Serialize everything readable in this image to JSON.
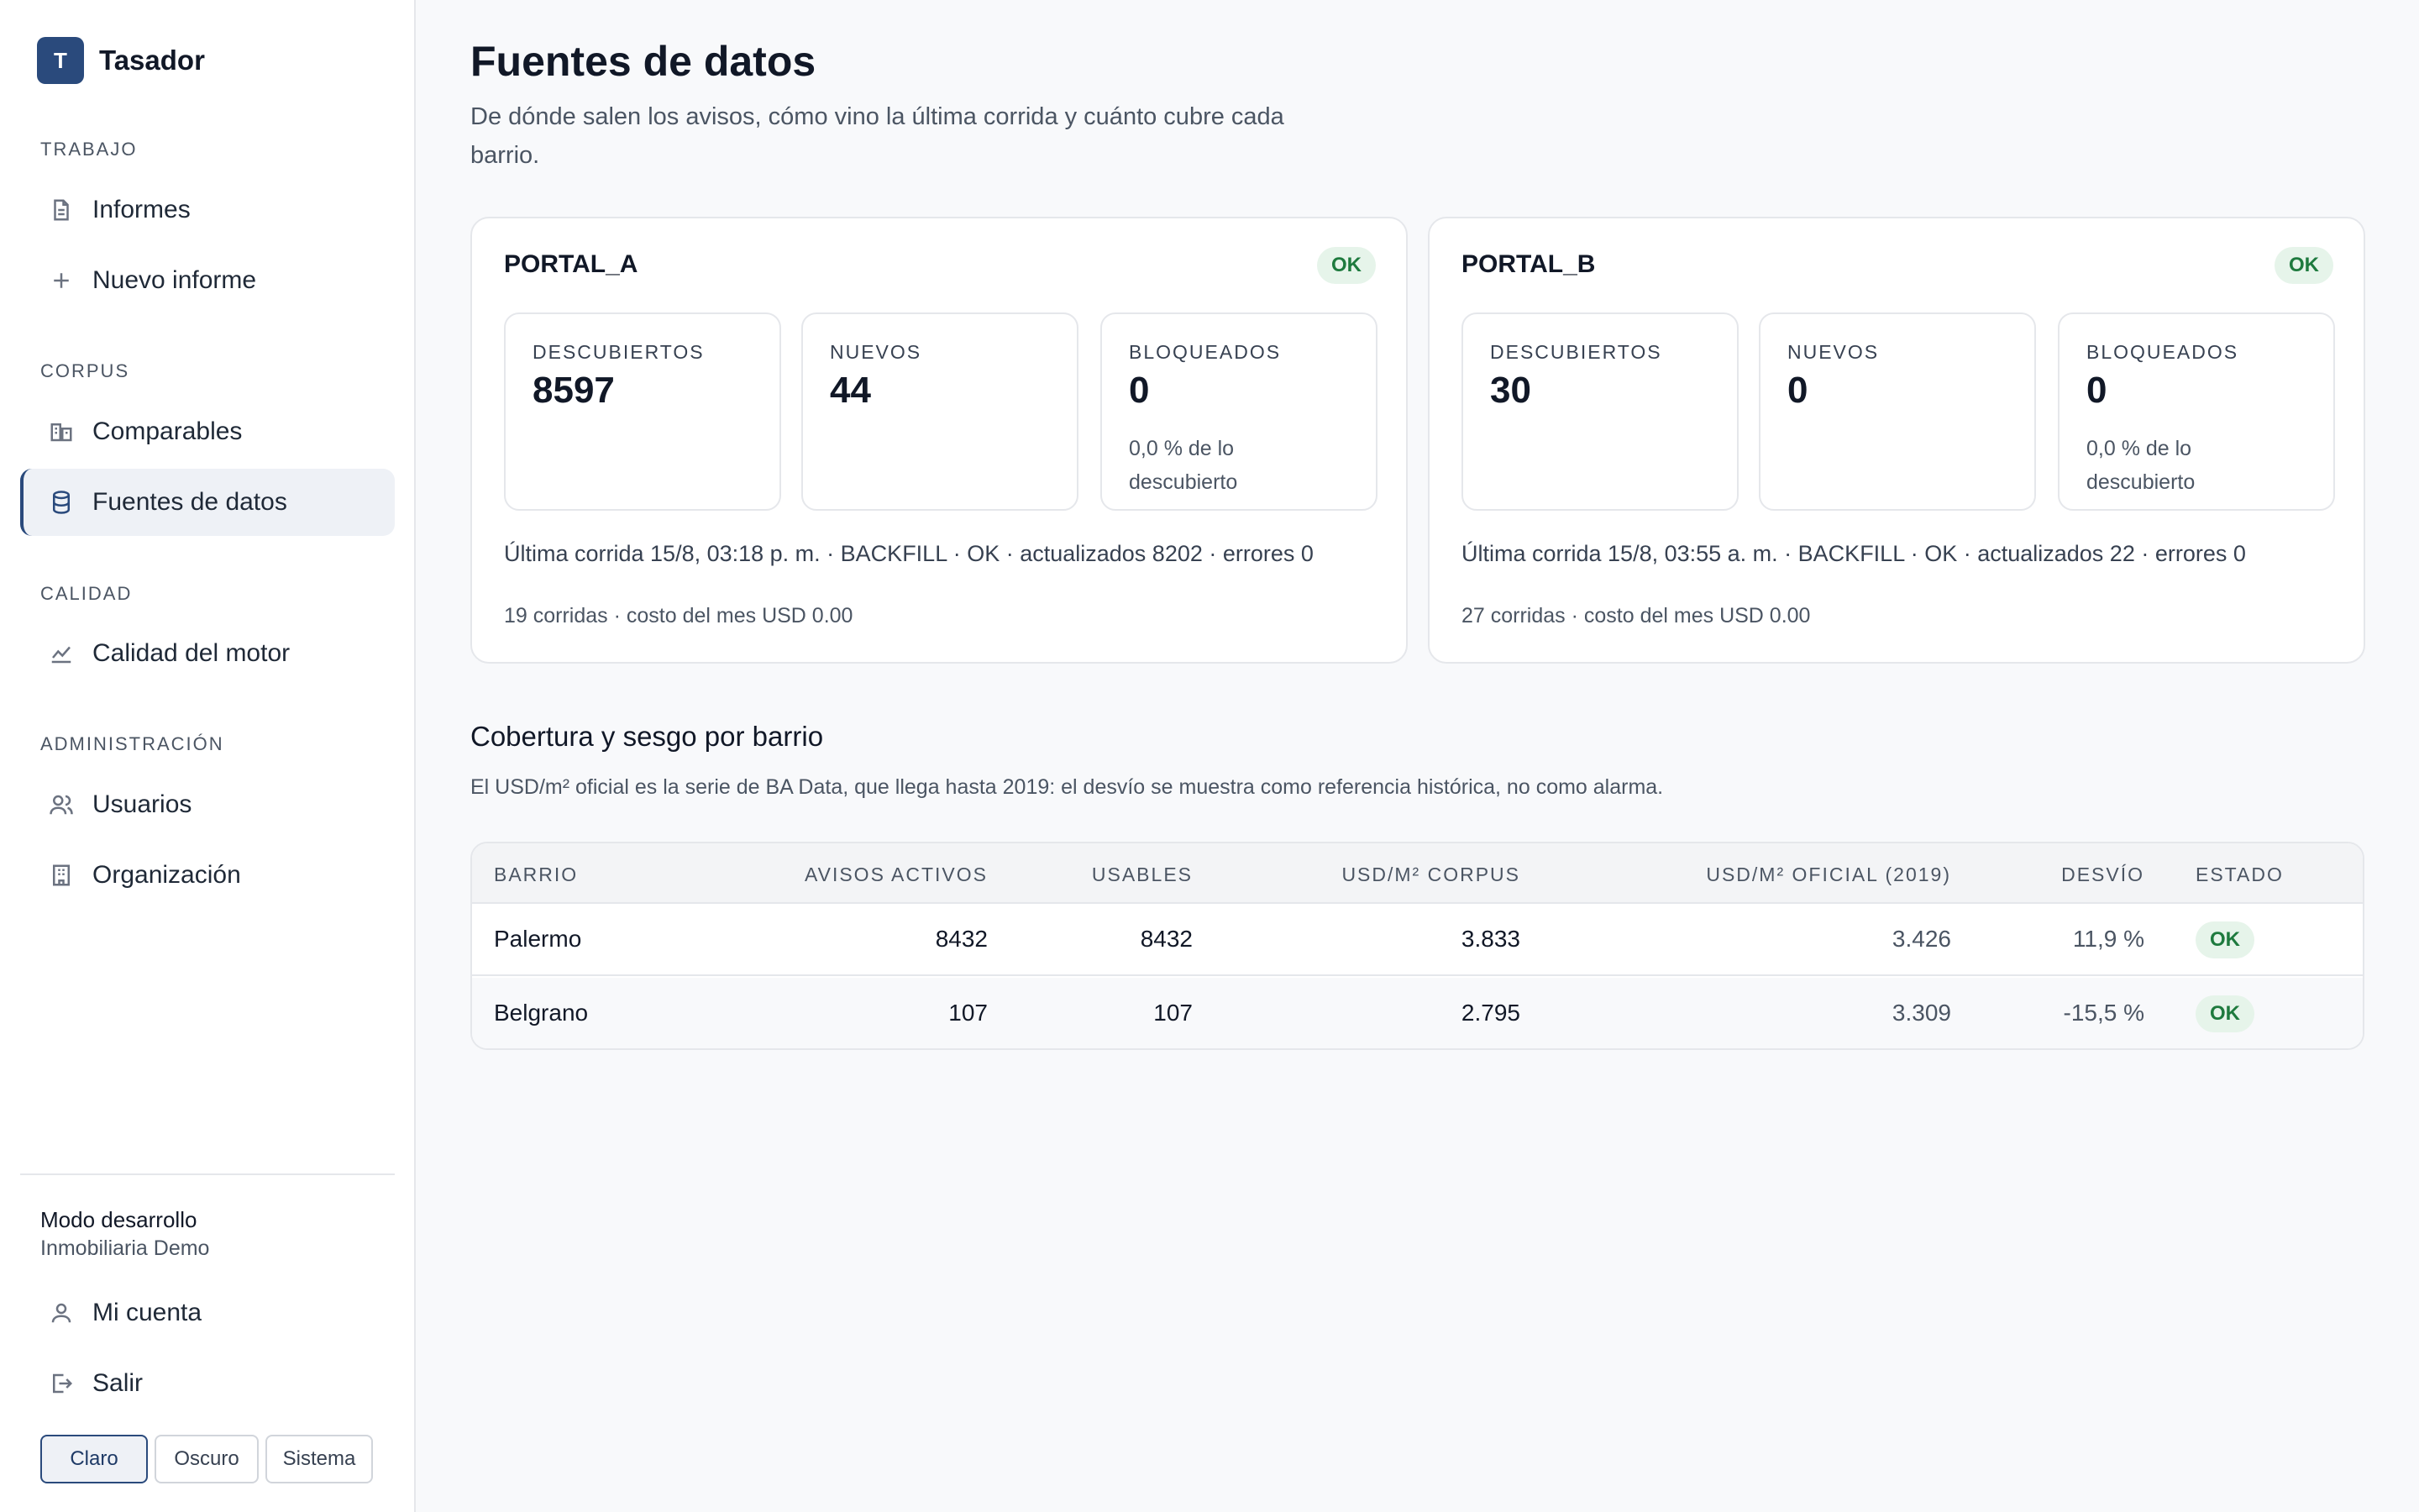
{
  "app": {
    "logo_letter": "T",
    "name": "Tasador"
  },
  "sidebar": {
    "sections": [
      {
        "title": "TRABAJO",
        "items": [
          {
            "label": "Informes",
            "icon": "document-icon"
          },
          {
            "label": "Nuevo informe",
            "icon": "plus-icon"
          }
        ]
      },
      {
        "title": "CORPUS",
        "items": [
          {
            "label": "Comparables",
            "icon": "buildings-icon"
          },
          {
            "label": "Fuentes de datos",
            "icon": "database-icon",
            "active": true
          }
        ]
      },
      {
        "title": "CALIDAD",
        "items": [
          {
            "label": "Calidad del motor",
            "icon": "line-chart-icon"
          }
        ]
      },
      {
        "title": "ADMINISTRACIÓN",
        "items": [
          {
            "label": "Usuarios",
            "icon": "users-icon"
          },
          {
            "label": "Organización",
            "icon": "building-icon"
          }
        ]
      }
    ],
    "footer": {
      "mode": "Modo desarrollo",
      "org": "Inmobiliaria Demo",
      "account": "Mi cuenta",
      "logout": "Salir",
      "themes": [
        "Claro",
        "Oscuro",
        "Sistema"
      ],
      "selected_theme": "Claro"
    }
  },
  "page": {
    "title": "Fuentes de datos",
    "subtitle": "De dónde salen los avisos, cómo vino la última corrida y cuánto cubre cada barrio."
  },
  "sources": [
    {
      "name": "PORTAL_A",
      "status": "OK",
      "stats": [
        {
          "label": "DESCUBIERTOS",
          "value": "8597"
        },
        {
          "label": "NUEVOS",
          "value": "44"
        },
        {
          "label": "BLOQUEADOS",
          "value": "0",
          "note": "0,0 % de lo descubierto"
        }
      ],
      "last_run": "Última corrida 15/8, 03:18 p. m. · BACKFILL · OK · actualizados 8202 · errores 0",
      "cost": "19 corridas · costo del mes USD 0.00"
    },
    {
      "name": "PORTAL_B",
      "status": "OK",
      "stats": [
        {
          "label": "DESCUBIERTOS",
          "value": "30"
        },
        {
          "label": "NUEVOS",
          "value": "0"
        },
        {
          "label": "BLOQUEADOS",
          "value": "0",
          "note": "0,0 % de lo descubierto"
        }
      ],
      "last_run": "Última corrida 15/8, 03:55 a. m. · BACKFILL · OK · actualizados 22 · errores 0",
      "cost": "27 corridas · costo del mes USD 0.00"
    }
  ],
  "coverage": {
    "title": "Cobertura y sesgo por barrio",
    "description": "El USD/m² oficial es la serie de BA Data, que llega hasta 2019: el desvío se muestra como referencia histórica, no como alarma.",
    "columns": [
      "BARRIO",
      "AVISOS ACTIVOS",
      "USABLES",
      "USD/M² CORPUS",
      "USD/M² OFICIAL (2019)",
      "DESVÍO",
      "ESTADO"
    ],
    "rows": [
      [
        "Palermo",
        "8432",
        "8432",
        "3.833",
        "3.426",
        "11,9 %",
        "OK"
      ],
      [
        "Belgrano",
        "107",
        "107",
        "2.795",
        "3.309",
        "-15,5 %",
        "OK"
      ]
    ]
  },
  "colors": {
    "accent": "#2a4a7c",
    "ok_bg": "#e6f4ea",
    "ok_text": "#1e7a3e"
  }
}
